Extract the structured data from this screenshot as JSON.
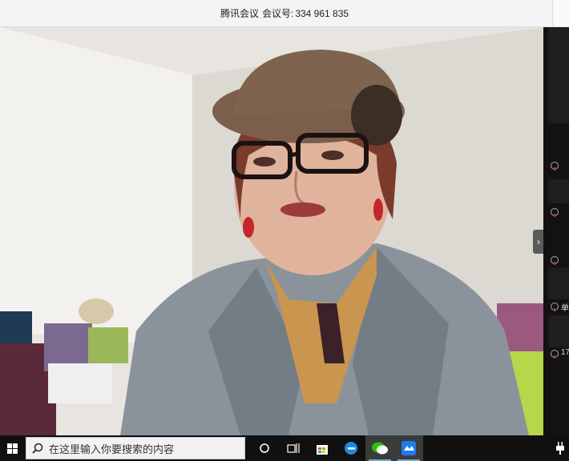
{
  "window": {
    "app_name": "腾讯会议",
    "meeting_label": "会议号:",
    "meeting_number": "334 961 835"
  },
  "participants_panel": {
    "visible_name_fragments": [
      "单",
      "17"
    ]
  },
  "video": {
    "expand_glyph": "›"
  },
  "taskbar": {
    "search_placeholder": "在这里输入你要搜索的内容",
    "icons": [
      "windows-start-icon",
      "search-icon",
      "cortana-icon",
      "task-view-icon",
      "store-icon",
      "edge-icon",
      "wechat-icon",
      "tencent-meeting-icon",
      "power-plug-icon"
    ],
    "colors": {
      "taskbar": "#101010",
      "wechat": "#2dc100",
      "tencent_meeting": "#1e7bf0",
      "edge": "#1e88e5"
    }
  }
}
